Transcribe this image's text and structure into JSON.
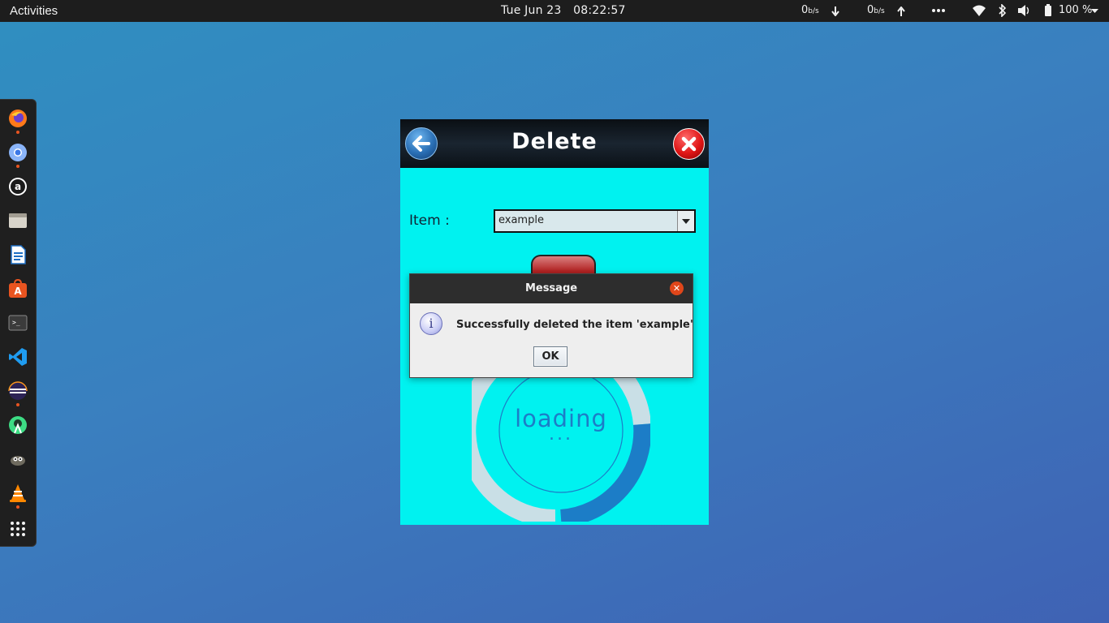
{
  "topbar": {
    "activities": "Activities",
    "date": "Tue Jun 23",
    "time": "08:22:57",
    "net_down_value": "0",
    "net_down_unit": "b/s",
    "net_up_value": "0",
    "net_up_unit": "b/s",
    "battery": "100 %"
  },
  "dock": {
    "apps": [
      "firefox",
      "chromium",
      "amazon",
      "files",
      "libreoffice-writer",
      "app-center",
      "terminal",
      "vscode",
      "eclipse",
      "android-studio",
      "gimp",
      "vlc",
      "show-apps"
    ]
  },
  "app": {
    "title": "Delete",
    "item_label": "Item :",
    "item_value": "example",
    "loading_text": "loading",
    "loading_dots": "..."
  },
  "dialog": {
    "title": "Message",
    "message": "Successfully deleted the item 'example'",
    "ok_label": "OK"
  },
  "colors": {
    "app_background": "#00f2f0",
    "loader_blue": "#1c7dc7",
    "dialog_close": "#e0461a"
  }
}
